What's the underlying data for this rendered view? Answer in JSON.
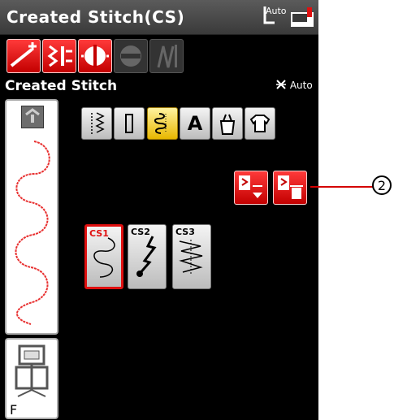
{
  "header": {
    "title": "Created Stitch(CS)",
    "auto_label": "Auto"
  },
  "subheader": {
    "title": "Created Stitch",
    "auto_label": "Auto"
  },
  "foot": {
    "label": "F"
  },
  "categories": [
    {
      "name": "straight-zigzag"
    },
    {
      "name": "buttonhole"
    },
    {
      "name": "decorative",
      "selected": true
    },
    {
      "name": "alphabet",
      "text": "A"
    },
    {
      "name": "bag"
    },
    {
      "name": "shirt"
    }
  ],
  "stitches": [
    {
      "label": "CS1",
      "selected": true
    },
    {
      "label": "CS2"
    },
    {
      "label": "CS3"
    }
  ],
  "callout": {
    "label": "2"
  },
  "colors": {
    "accent_red": "#e01010",
    "selected_yellow": "#e8b800",
    "background": "#000000"
  }
}
